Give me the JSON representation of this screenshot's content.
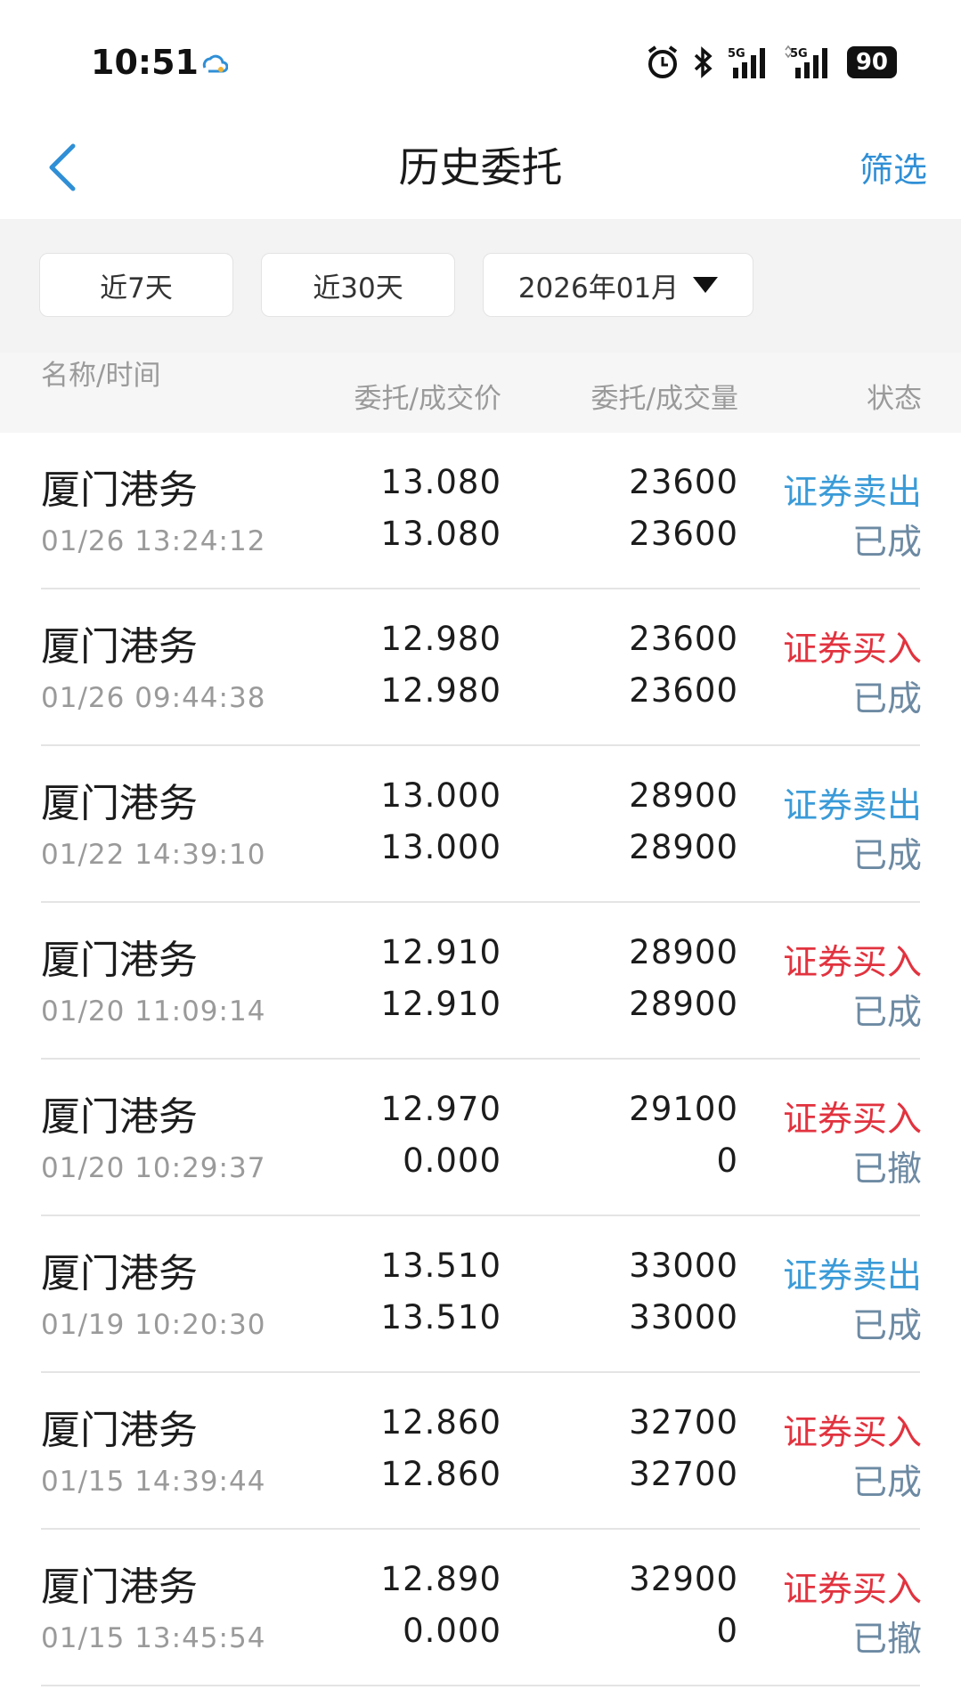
{
  "status_bar": {
    "time": "10:51",
    "battery": "90",
    "icons": [
      "weather-icon",
      "alarm-icon",
      "bluetooth-icon",
      "signal-5g-icon",
      "signal-5g-icon"
    ],
    "network_label": "5G"
  },
  "nav": {
    "back_icon": "chevron-left-icon",
    "title": "历史委托",
    "filter_label": "筛选",
    "accent": "#2f8fd6"
  },
  "periods": {
    "p7": "近7天",
    "p30": "近30天",
    "month": "2026年01月"
  },
  "columns": {
    "name": "名称/时间",
    "price": "委托/成交价",
    "qty": "委托/成交量",
    "status": "状态"
  },
  "colors": {
    "sell": "#3a9bd8",
    "buy": "#e2333f",
    "state": "#6d8aa3"
  },
  "rows": [
    {
      "name": "厦门港务",
      "time": "01/26 13:24:12",
      "order_price": "13.080",
      "deal_price": "13.080",
      "order_qty": "23600",
      "deal_qty": "23600",
      "type": "证券卖出",
      "side": "sell",
      "state": "已成"
    },
    {
      "name": "厦门港务",
      "time": "01/26 09:44:38",
      "order_price": "12.980",
      "deal_price": "12.980",
      "order_qty": "23600",
      "deal_qty": "23600",
      "type": "证券买入",
      "side": "buy",
      "state": "已成"
    },
    {
      "name": "厦门港务",
      "time": "01/22 14:39:10",
      "order_price": "13.000",
      "deal_price": "13.000",
      "order_qty": "28900",
      "deal_qty": "28900",
      "type": "证券卖出",
      "side": "sell",
      "state": "已成"
    },
    {
      "name": "厦门港务",
      "time": "01/20 11:09:14",
      "order_price": "12.910",
      "deal_price": "12.910",
      "order_qty": "28900",
      "deal_qty": "28900",
      "type": "证券买入",
      "side": "buy",
      "state": "已成"
    },
    {
      "name": "厦门港务",
      "time": "01/20 10:29:37",
      "order_price": "12.970",
      "deal_price": "0.000",
      "order_qty": "29100",
      "deal_qty": "0",
      "type": "证券买入",
      "side": "buy",
      "state": "已撤"
    },
    {
      "name": "厦门港务",
      "time": "01/19 10:20:30",
      "order_price": "13.510",
      "deal_price": "13.510",
      "order_qty": "33000",
      "deal_qty": "33000",
      "type": "证券卖出",
      "side": "sell",
      "state": "已成"
    },
    {
      "name": "厦门港务",
      "time": "01/15 14:39:44",
      "order_price": "12.860",
      "deal_price": "12.860",
      "order_qty": "32700",
      "deal_qty": "32700",
      "type": "证券买入",
      "side": "buy",
      "state": "已成"
    },
    {
      "name": "厦门港务",
      "time": "01/15 13:45:54",
      "order_price": "12.890",
      "deal_price": "0.000",
      "order_qty": "32900",
      "deal_qty": "0",
      "type": "证券买入",
      "side": "buy",
      "state": "已撤"
    }
  ]
}
